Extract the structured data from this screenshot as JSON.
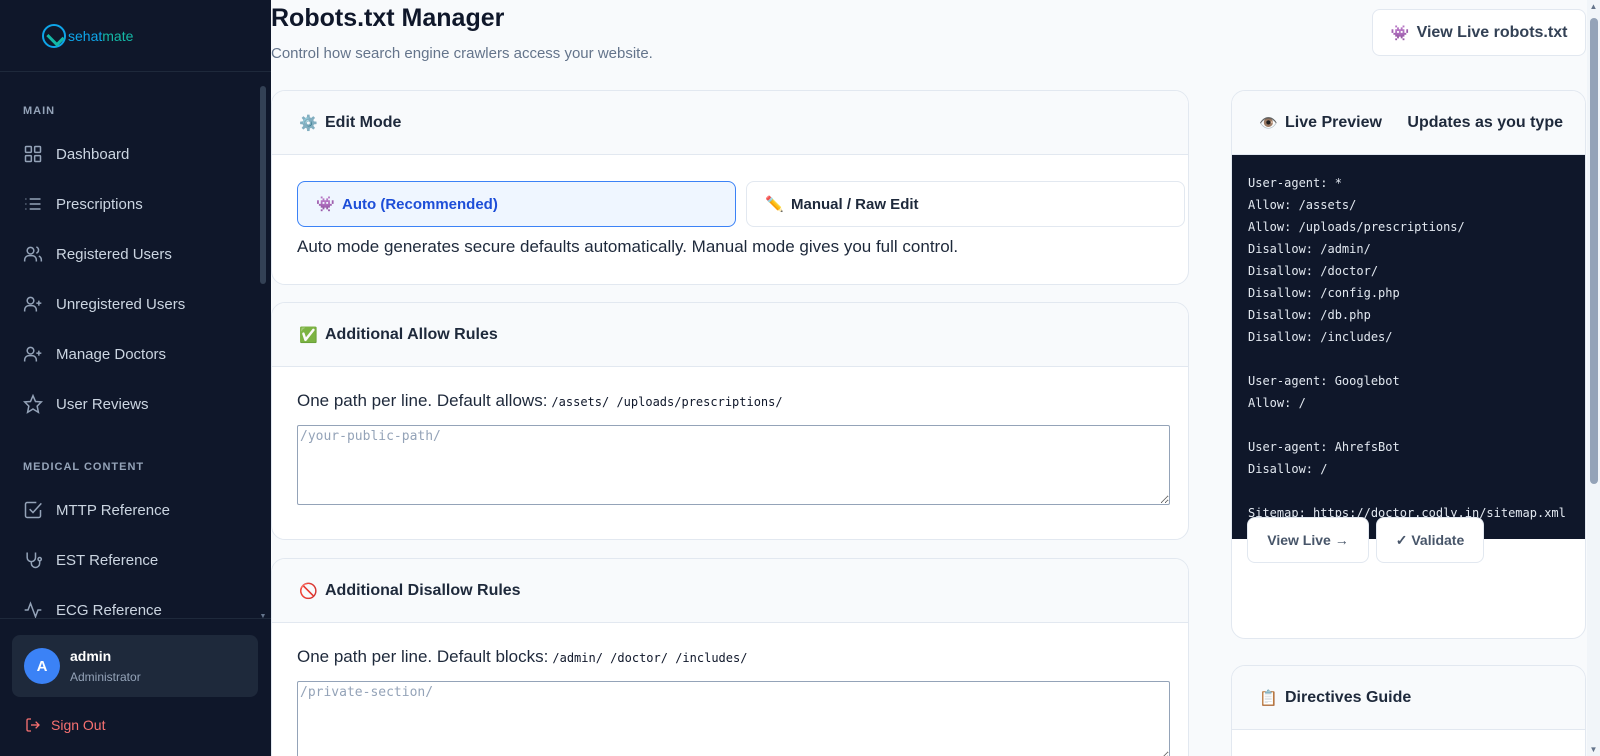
{
  "brand": {
    "logo_part1": "sehat",
    "logo_part2": "mate"
  },
  "sidebar": {
    "sections": [
      {
        "title": "MAIN"
      },
      {
        "title": "MEDICAL CONTENT"
      }
    ],
    "items": [
      {
        "label": "Dashboard",
        "icon": "grid-icon"
      },
      {
        "label": "Prescriptions",
        "icon": "list-icon"
      },
      {
        "label": "Registered Users",
        "icon": "users-icon"
      },
      {
        "label": "Unregistered Users",
        "icon": "user-plus-icon"
      },
      {
        "label": "Manage Doctors",
        "icon": "user-plus-icon"
      },
      {
        "label": "User Reviews",
        "icon": "star-icon"
      },
      {
        "label": "MTTP Reference",
        "icon": "checkbox-icon"
      },
      {
        "label": "EST Reference",
        "icon": "stethoscope-icon"
      },
      {
        "label": "ECG Reference",
        "icon": "activity-icon"
      }
    ],
    "user": {
      "initial": "A",
      "name": "admin",
      "role": "Administrator"
    },
    "signout_label": "Sign Out"
  },
  "header": {
    "title": "Robots.txt Manager",
    "subtitle": "Control how search engine crawlers access your website.",
    "view_live_label": "View Live robots.txt",
    "view_live_emoji": "👾"
  },
  "edit_mode": {
    "title": "Edit Mode",
    "emoji": "⚙️",
    "auto_label": "Auto (Recommended)",
    "auto_emoji": "👾",
    "manual_label": "Manual / Raw Edit",
    "manual_emoji": "✏️",
    "note": "Auto mode generates secure defaults automatically. Manual mode gives you full control.",
    "selected": "auto"
  },
  "allow_rules": {
    "title": "Additional Allow Rules",
    "emoji": "✅",
    "hint": "One path per line. Default allows:",
    "defaults": "/assets/ /uploads/prescriptions/",
    "value": "",
    "placeholder": "/your-public-path/"
  },
  "disallow_rules": {
    "title": "Additional Disallow Rules",
    "emoji": "🚫",
    "hint": "One path per line. Default blocks:",
    "defaults": "/admin/ /doctor/ /includes/",
    "value": "",
    "placeholder": "/private-section/"
  },
  "preview": {
    "title": "Live Preview",
    "emoji": "👁️",
    "badge": "Updates as you type",
    "content": "User-agent: *\nAllow: /assets/\nAllow: /uploads/prescriptions/\nDisallow: /admin/\nDisallow: /doctor/\nDisallow: /config.php\nDisallow: /db.php\nDisallow: /includes/\n\nUser-agent: Googlebot\nAllow: /\n\nUser-agent: AhrefsBot\nDisallow: /\n\nSitemap: https://doctor.codly.in/sitemap.xml",
    "view_live_label": "View Live →",
    "validate_label": "✓ Validate"
  },
  "guide": {
    "title": "Directives Guide",
    "emoji": "📋"
  },
  "colors": {
    "sidebar_bg": "#0f172a",
    "accent": "#3b82f6",
    "danger": "#f87171"
  }
}
